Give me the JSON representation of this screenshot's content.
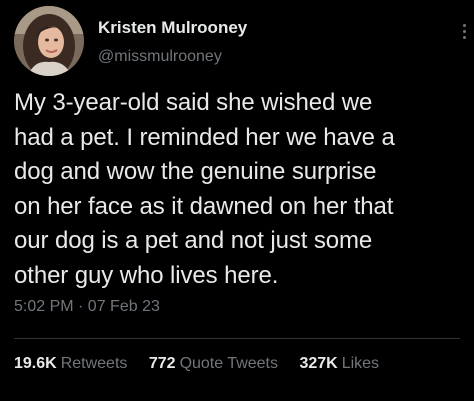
{
  "user": {
    "display_name": "Kristen Mulrooney",
    "handle": "@missmulrooney"
  },
  "tweet": {
    "lines": [
      "My 3-year-old said she wished we",
      "had a pet. I reminded her we have a",
      "dog and wow the genuine surprise",
      "on her face as it dawned on her that",
      "our dog is a pet and not just some",
      "other guy who lives here."
    ],
    "timestamp": "5:02 PM · 07 Feb 23"
  },
  "stats": {
    "retweets_count": "19.6K",
    "retweets_label": "Retweets",
    "quotes_count": "772",
    "quotes_label": "Quote Tweets",
    "likes_count": "327K",
    "likes_label": "Likes"
  },
  "icons": {
    "more": "more-vertical-icon"
  },
  "colors": {
    "background": "#000000",
    "primary_text": "#e7e9ea",
    "secondary_text": "#71767b",
    "divider": "#2f3336"
  }
}
